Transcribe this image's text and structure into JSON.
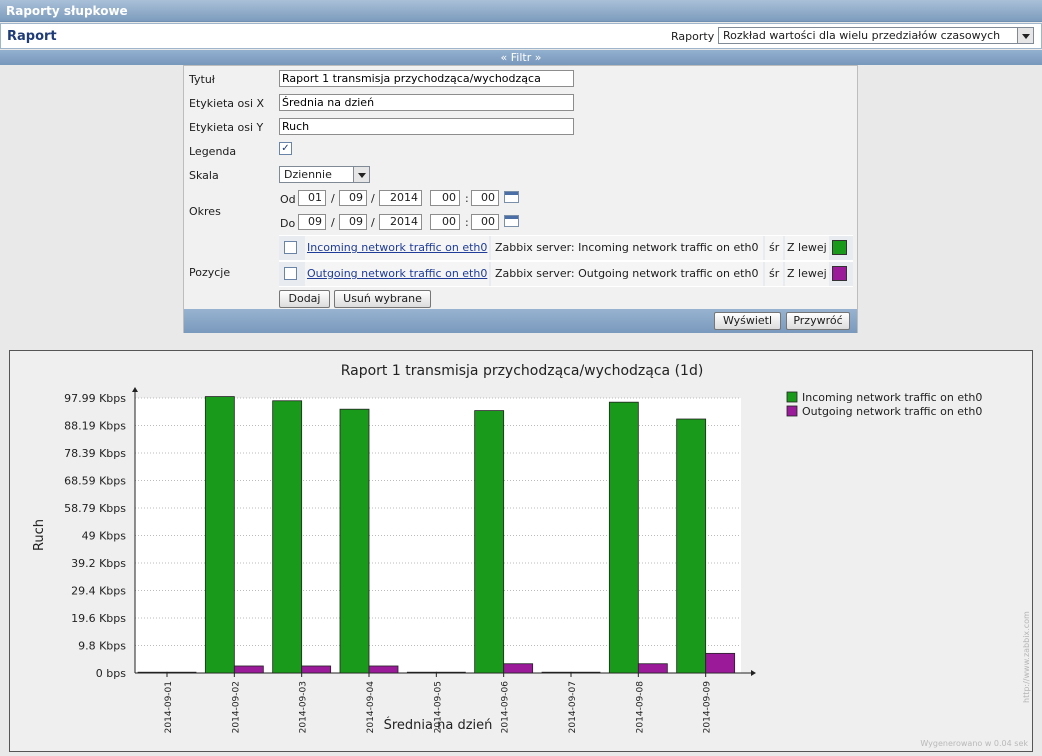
{
  "app": {
    "title": "Raporty słupkowe"
  },
  "header": {
    "title": "Raport",
    "reports_label": "Raporty",
    "reports_selected": "Rozkład wartości dla wielu przedziałów czasowych"
  },
  "filter": {
    "toggle_label": "« Filtr »",
    "title_label": "Tytuł",
    "title_value": "Raport 1 transmisja przychodząca/wychodząca",
    "xlabel_label": "Etykieta osi X",
    "xlabel_value": "Średnia na dzień",
    "ylabel_label": "Etykieta osi Y",
    "ylabel_value": "Ruch",
    "legend_label": "Legenda",
    "legend_checked": true,
    "scale_label": "Skala",
    "scale_value": "Dziennie",
    "period_label": "Okres",
    "from_label": "Od",
    "to_label": "Do",
    "from": {
      "day": "01",
      "month": "09",
      "year": "2014",
      "hour": "00",
      "minute": "00"
    },
    "to": {
      "day": "09",
      "month": "09",
      "year": "2014",
      "hour": "00",
      "minute": "00"
    },
    "date_sep": "/",
    "time_sep": ":",
    "items_label": "Pozycje",
    "items": [
      {
        "name": "Incoming network traffic on eth0",
        "full": "Zabbix server: Incoming network traffic on eth0",
        "func": "śr",
        "axis": "Z lewej",
        "color": "#1a9a1a"
      },
      {
        "name": "Outgoing network traffic on eth0",
        "full": "Zabbix server: Outgoing network traffic on eth0",
        "func": "śr",
        "axis": "Z lewej",
        "color": "#9a1a9a"
      }
    ],
    "add_button": "Dodaj",
    "remove_button": "Usuń wybrane",
    "show_button": "Wyświetl",
    "reset_button": "Przywróć"
  },
  "chart_data": {
    "type": "bar",
    "title": "Raport 1 transmisja przychodząca/wychodząca (1d)",
    "xlabel": "Średnia na dzień",
    "ylabel": "Ruch",
    "categories": [
      "2014-09-01",
      "2014-09-02",
      "2014-09-03",
      "2014-09-04",
      "2014-09-05",
      "2014-09-06",
      "2014-09-07",
      "2014-09-08",
      "2014-09-09"
    ],
    "y_ticks": [
      "0 bps",
      "9.8 Kbps",
      "19.6 Kbps",
      "29.4 Kbps",
      "39.2 Kbps",
      "49 Kbps",
      "58.79 Kbps",
      "68.59 Kbps",
      "78.39 Kbps",
      "88.19 Kbps",
      "97.99 Kbps"
    ],
    "ylim": [
      0,
      97.99
    ],
    "y_unit": "Kbps",
    "series": [
      {
        "name": "Incoming network traffic on eth0",
        "color": "#1a9a1a",
        "values": [
          0,
          98.5,
          97.0,
          94.0,
          0,
          93.5,
          0,
          96.5,
          90.5
        ]
      },
      {
        "name": "Outgoing network traffic on eth0",
        "color": "#9a1a9a",
        "values": [
          0,
          2.5,
          2.5,
          2.5,
          0,
          3.3,
          0,
          3.3,
          7.0
        ]
      }
    ],
    "legend_position": "top-right",
    "grid": true
  },
  "footer": {
    "watermark": "Wygenerowano w 0.04 sek",
    "side_url": "http://www.zabbix.com"
  }
}
